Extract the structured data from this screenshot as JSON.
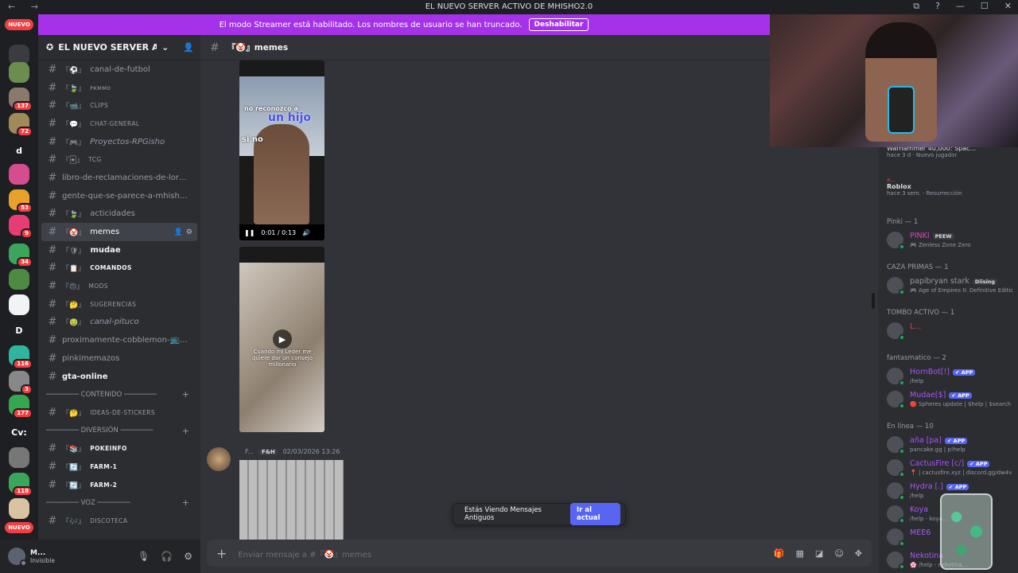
{
  "window": {
    "title": "EL NUEVO SERVER ACTIVO DE MHISHO2.0",
    "nav": "← →",
    "controls": [
      "⧉",
      "?",
      "—",
      "☐",
      "✕"
    ]
  },
  "rail": {
    "nuevo_top": "NUEVO",
    "nuevo_bottom": "NUEVO",
    "servers": [
      {
        "label": "",
        "color": "#3a3c42",
        "badge": ""
      },
      {
        "label": "",
        "color": "#6b8e4e",
        "badge": ""
      },
      {
        "label": "",
        "color": "#8a7a6a",
        "badge": "137"
      },
      {
        "label": "",
        "color": "#a08a5a",
        "badge": "72"
      },
      {
        "label": "d",
        "color": "#1e1f22",
        "badge": ""
      },
      {
        "label": "",
        "color": "#d64d8f",
        "badge": ""
      },
      {
        "label": "",
        "color": "#e8a22b",
        "badge": "53"
      },
      {
        "label": "",
        "color": "#e83d74",
        "badge": "9"
      },
      {
        "label": "",
        "color": "#3ba55c",
        "badge": "34"
      },
      {
        "label": "",
        "color": "#4f8a42",
        "badge": ""
      },
      {
        "label": "",
        "color": "#f2f3f5",
        "badge": ""
      },
      {
        "label": "D",
        "color": "#1e1f22",
        "badge": ""
      },
      {
        "label": "",
        "color": "#2fb4a0",
        "badge": "116"
      },
      {
        "label": "",
        "color": "#888",
        "badge": "3"
      },
      {
        "label": "",
        "color": "#36a64f",
        "badge": "177"
      },
      {
        "label": "Cv:",
        "color": "#1e1f22",
        "badge": ""
      },
      {
        "label": "",
        "color": "#777",
        "badge": ""
      },
      {
        "label": "",
        "color": "#3ba55c",
        "badge": "118"
      },
      {
        "label": "",
        "color": "#d9c3a0",
        "badge": ""
      }
    ]
  },
  "banner": {
    "text": "El modo Streamer está habilitado. Los nombres de usuario se han truncado.",
    "button": "Deshabilitar"
  },
  "guild": {
    "name": "EL NUEVO SERVER ACTI...",
    "channels": [
      {
        "type": "ch",
        "prefix": "『⚽』",
        "label": "canal-de-futbol",
        "style": ""
      },
      {
        "type": "ch",
        "prefix": "『🍃』",
        "label": "ᴘᴋᴍᴍᴏ",
        "style": "small"
      },
      {
        "type": "ch",
        "prefix": "『📹』",
        "label": "CLIPS",
        "style": "small"
      },
      {
        "type": "ch",
        "prefix": "『💬』",
        "label": "CHAT-GENERAL",
        "style": "small"
      },
      {
        "type": "ch",
        "prefix": "『🎮』",
        "label": "Proyectos-RPGisho",
        "style": "italic"
      },
      {
        "type": "ch",
        "prefix": "『🃏』",
        "label": "TCG",
        "style": "small"
      },
      {
        "type": "ch",
        "prefix": "",
        "label": "libro-de-reclamaciones-de-lord-...",
        "style": ""
      },
      {
        "type": "ch",
        "prefix": "",
        "label": "gente-que-se-parece-a-mhisho-...",
        "style": ""
      },
      {
        "type": "ch",
        "prefix": "『🍃』",
        "label": "acticidades",
        "style": ""
      },
      {
        "type": "ch",
        "prefix": "『🤡』",
        "label": "memes",
        "style": "sel"
      },
      {
        "type": "ch",
        "prefix": "『🛡』",
        "label": "mudae",
        "style": "bold"
      },
      {
        "type": "ch",
        "prefix": "『📋』",
        "label": "COMANDOS",
        "style": "small bold"
      },
      {
        "type": "ch",
        "prefix": "『😠』",
        "label": "MODS",
        "style": "small"
      },
      {
        "type": "ch",
        "prefix": "『🤔』",
        "label": "SUGERENCIAS",
        "style": "small"
      },
      {
        "type": "ch",
        "prefix": "『🤢』",
        "label": "canal-pituco",
        "style": "italic"
      },
      {
        "type": "ch",
        "prefix": "",
        "label": "proximamente-cobblemon-📺🍃...",
        "style": ""
      },
      {
        "type": "ch",
        "prefix": "",
        "label": "pinkimemazos",
        "style": ""
      },
      {
        "type": "ch",
        "prefix": "",
        "label": "gta-online",
        "style": "bold"
      },
      {
        "type": "cat",
        "label": "──────── CONTENIDO ────────"
      },
      {
        "type": "ch",
        "prefix": "『🤔』",
        "label": "IDEAS-DE-STICKERS",
        "style": "small"
      },
      {
        "type": "cat",
        "label": "──────── DIVERSIÓN ────────"
      },
      {
        "type": "ch",
        "prefix": "『📚』",
        "label": "POKEINFO",
        "style": "small bold"
      },
      {
        "type": "ch",
        "prefix": "『🔄』",
        "label": "FARM-1",
        "style": "small bold"
      },
      {
        "type": "ch",
        "prefix": "『🔄』",
        "label": "FARM-2",
        "style": "small bold"
      },
      {
        "type": "cat",
        "label": "──────── VOZ ────────"
      },
      {
        "type": "ch",
        "prefix": "『🎶』",
        "label": "DISCOTECA",
        "style": "small"
      }
    ]
  },
  "user": {
    "name": "M...",
    "status": "Invisible"
  },
  "chat": {
    "channel": "『🤡』memes",
    "video1": {
      "caption_a": "no reconozco a",
      "caption_b": "un hijo",
      "caption_c": "si no",
      "time": "0:01 / 0:13"
    },
    "video2": {
      "caption": "Cuando mi Leder me quiere dar un consejo millonario"
    },
    "message": {
      "author": "F...",
      "tag": "F&H",
      "timestamp": "02/03/2026 13:26"
    },
    "toast": {
      "text": "Estás Viendo Mensajes Antiguos",
      "button": "Ir al actual"
    },
    "composer_placeholder": "Enviar mensaje a #『🤡』memes"
  },
  "members": {
    "activity1": {
      "title": "Warhammer 40,000: Spac...",
      "sub": "hace 3 d · Nuevo jugador"
    },
    "activity2": {
      "user": "a...",
      "title": "Roblox",
      "sub": "hace 3 sem. · Resurrección"
    },
    "sections": [
      {
        "header": "Pinki — 1",
        "members": [
          {
            "name": "PINKI",
            "badge": "PEEW",
            "badge_type": "tag",
            "status": "🎮 Zenless Zone Zero",
            "color": "#e83dc0"
          }
        ]
      },
      {
        "header": "CAZA PRIMAS — 1",
        "members": [
          {
            "name": "papibryan stark",
            "badge": "Diising",
            "badge_type": "tag",
            "status": "🎮 Age of Empires II: Definitive Editic",
            "color": "#949ba4"
          }
        ]
      },
      {
        "header": "TOMBO ACTIVO — 1",
        "members": [
          {
            "name": "L...",
            "badge": "",
            "badge_type": "",
            "status": "",
            "color": "#f23f43"
          }
        ]
      },
      {
        "header": "fantasmatico — 2",
        "members": [
          {
            "name": "HornBot[!]",
            "badge": "✔ APP",
            "badge_type": "app",
            "status": "/help",
            "color": "#a855f7"
          },
          {
            "name": "Mudae[$]",
            "badge": "✔ APP",
            "badge_type": "app",
            "status": "🔴 Spheres update | $help | $search",
            "color": "#a855f7"
          }
        ]
      },
      {
        "header": "En línea — 10",
        "members": [
          {
            "name": "aña [pa]",
            "badge": "✔ APP",
            "badge_type": "app",
            "status": "pancake.gg | p!help",
            "color": "#a855f7"
          },
          {
            "name": "CactusFire [c/]",
            "badge": "✔ APP",
            "badge_type": "app",
            "status": "📍 | cactusfire.xyz | discord.gg/dw4v",
            "color": "#a855f7"
          },
          {
            "name": "Hydra [.]",
            "badge": "✔ APP",
            "badge_type": "app",
            "status": "/help",
            "color": "#a855f7"
          },
          {
            "name": "Koya",
            "badge": "",
            "badge_type": "",
            "status": "/help - koya...",
            "color": "#a855f7"
          },
          {
            "name": "MEE6",
            "badge": "",
            "badge_type": "",
            "status": "",
            "color": "#a855f7"
          },
          {
            "name": "Nekotina",
            "badge": "",
            "badge_type": "",
            "status": "🌸 /help - nekotina...",
            "color": "#a855f7"
          }
        ]
      }
    ]
  }
}
